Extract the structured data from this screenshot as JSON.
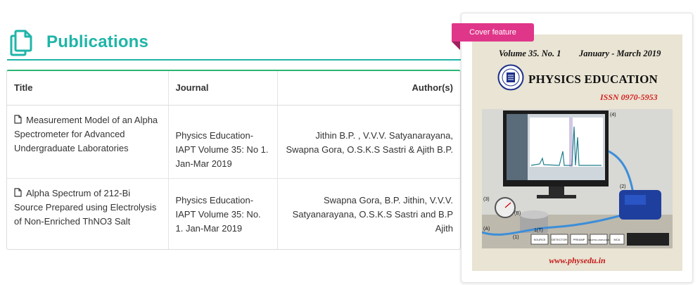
{
  "section": {
    "title": "Publications",
    "icon": "copy-documents-icon",
    "accent_color": "#1fb5a8"
  },
  "table": {
    "headers": {
      "title": "Title",
      "journal": "Journal",
      "authors": "Author(s)"
    },
    "rows": [
      {
        "title": "Measurement Model of an Alpha Spectrometer for Advanced Undergraduate Laboratories",
        "journal": "Physics Education-IAPT Volume 35: No 1. Jan-Mar 2019",
        "authors": "Jithin B.P. , V.V.V. Satyanarayana, Swapna Gora, O.S.K.S Sastri & Ajith B.P.",
        "icon": "document-icon"
      },
      {
        "title": "Alpha Spectrum of 212-Bi Source Prepared using Electrolysis of Non-Enriched ThNO3 Salt",
        "journal": "Physics Education-IAPT Volume 35: No. 1. Jan-Mar 2019",
        "authors": "Swapna Gora, B.P. Jithin, V.V.V. Satyanarayana, O.S.K.S Sastri and B.P Ajith",
        "icon": "document-icon"
      }
    ]
  },
  "cover_feature": {
    "ribbon_label": "Cover feature",
    "ribbon_color": "#e0368a",
    "volume": "Volume 35. No. 1",
    "date": "January - March 2019",
    "journal_name": "PHYSICS EDUCATION",
    "issn": "ISSN 0970-5953",
    "url": "www.physedu.in",
    "photo_labels": [
      "(4)",
      "(2)",
      "(3)",
      "(B)",
      "(A)",
      "1(T)",
      "(1)",
      "SOURCE",
      "DETECTOR",
      "PREAMP",
      "SHAPING AMPLIFIER",
      "MCA"
    ]
  }
}
